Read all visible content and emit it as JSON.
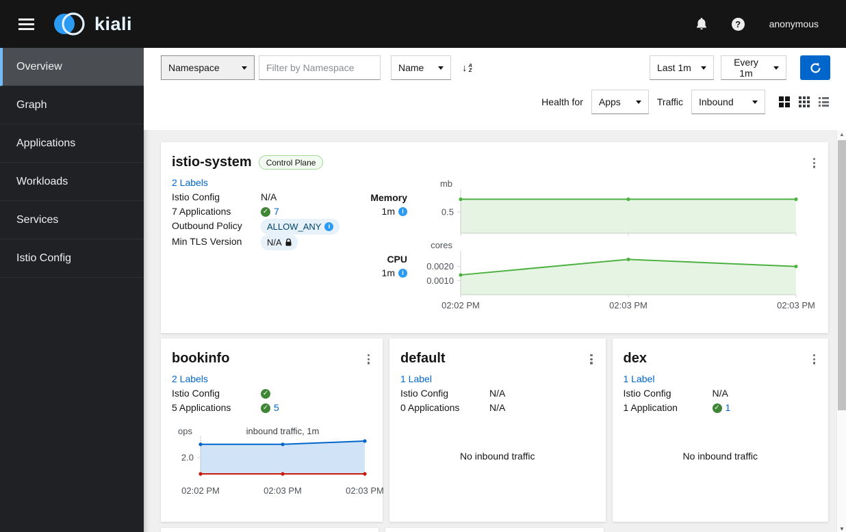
{
  "masthead": {
    "brand": "kiali",
    "user": "anonymous"
  },
  "sidebar": {
    "items": [
      {
        "label": "Overview",
        "active": true
      },
      {
        "label": "Graph",
        "active": false
      },
      {
        "label": "Applications",
        "active": false
      },
      {
        "label": "Workloads",
        "active": false
      },
      {
        "label": "Services",
        "active": false
      },
      {
        "label": "Istio Config",
        "active": false
      }
    ]
  },
  "toolbar": {
    "filter_type": "Namespace",
    "filter_placeholder": "Filter by Namespace",
    "sort_field": "Name",
    "duration": "Last 1m",
    "refresh_interval": "Every 1m",
    "health_for_label": "Health for",
    "health_for_value": "Apps",
    "traffic_label": "Traffic",
    "traffic_value": "Inbound"
  },
  "colors": {
    "accent": "#0066cc",
    "success": "#3e8635",
    "chart_green": "#4cb140",
    "chart_blue": "#0066cc",
    "chart_red": "#c9190b"
  },
  "cards": {
    "istio_system": {
      "title": "istio-system",
      "badge": "Control Plane",
      "labels_link": "2 Labels",
      "rows": [
        {
          "label": "Istio Config",
          "value": "N/A"
        },
        {
          "label": "7 Applications",
          "value": "7"
        },
        {
          "label": "Outbound Policy",
          "value": "ALLOW_ANY"
        },
        {
          "label": "Min TLS Version",
          "value": "N/A"
        }
      ],
      "memory_label": "Memory",
      "memory_duration": "1m",
      "cpu_label": "CPU",
      "cpu_duration": "1m"
    },
    "bookinfo": {
      "title": "bookinfo",
      "labels_link": "2 Labels",
      "rows": [
        {
          "label": "Istio Config",
          "value": ""
        },
        {
          "label": "5 Applications",
          "value": "5"
        }
      ]
    },
    "default": {
      "title": "default",
      "labels_link": "1 Label",
      "rows": [
        {
          "label": "Istio Config",
          "value": "N/A"
        },
        {
          "label": "0 Applications",
          "value": "N/A"
        }
      ],
      "empty_message": "No inbound traffic"
    },
    "dex": {
      "title": "dex",
      "labels_link": "1 Label",
      "rows": [
        {
          "label": "Istio Config",
          "value": "N/A"
        },
        {
          "label": "1 Application",
          "value": "1"
        }
      ],
      "empty_message": "No inbound traffic"
    }
  },
  "chart_data": [
    {
      "id": "memory",
      "type": "area",
      "title": "",
      "unit": "mb",
      "x_labels": [
        "02:02 PM",
        "02:03 PM",
        "02:03 PM"
      ],
      "ymax": 1.0,
      "ticks": [
        {
          "value": 0.5,
          "label": "0.5"
        }
      ],
      "series": [
        {
          "name": "memory",
          "color": "#4cb140",
          "fill": "rgba(76,177,64,0.14)",
          "values": [
            0.8,
            0.8,
            0.8
          ]
        }
      ]
    },
    {
      "id": "cpu",
      "type": "area",
      "title": "",
      "unit": "cores",
      "x_labels": [
        "02:02 PM",
        "02:03 PM",
        "02:03 PM"
      ],
      "ymax": 0.003,
      "ticks": [
        {
          "value": 0.002,
          "label": "0.0020"
        },
        {
          "value": 0.001,
          "label": "0.0010"
        }
      ],
      "series": [
        {
          "name": "cpu",
          "color": "#4cb140",
          "fill": "rgba(76,177,64,0.14)",
          "values": [
            0.0014,
            0.0025,
            0.002
          ]
        }
      ]
    },
    {
      "id": "bookinfo_inbound",
      "type": "area",
      "title": "inbound traffic, 1m",
      "unit": "ops",
      "x_labels": [
        "02:02 PM",
        "02:03 PM",
        "02:03 PM"
      ],
      "ymax": 4.5,
      "ticks": [
        {
          "value": 2.0,
          "label": "2.0"
        }
      ],
      "series": [
        {
          "name": "total",
          "color": "#0066cc",
          "fill": "rgba(0,102,204,0.18)",
          "values": [
            3.6,
            3.6,
            4.0
          ]
        },
        {
          "name": "errors",
          "color": "#c9190b",
          "fill": "none",
          "values": [
            0,
            0,
            0
          ]
        }
      ]
    }
  ]
}
